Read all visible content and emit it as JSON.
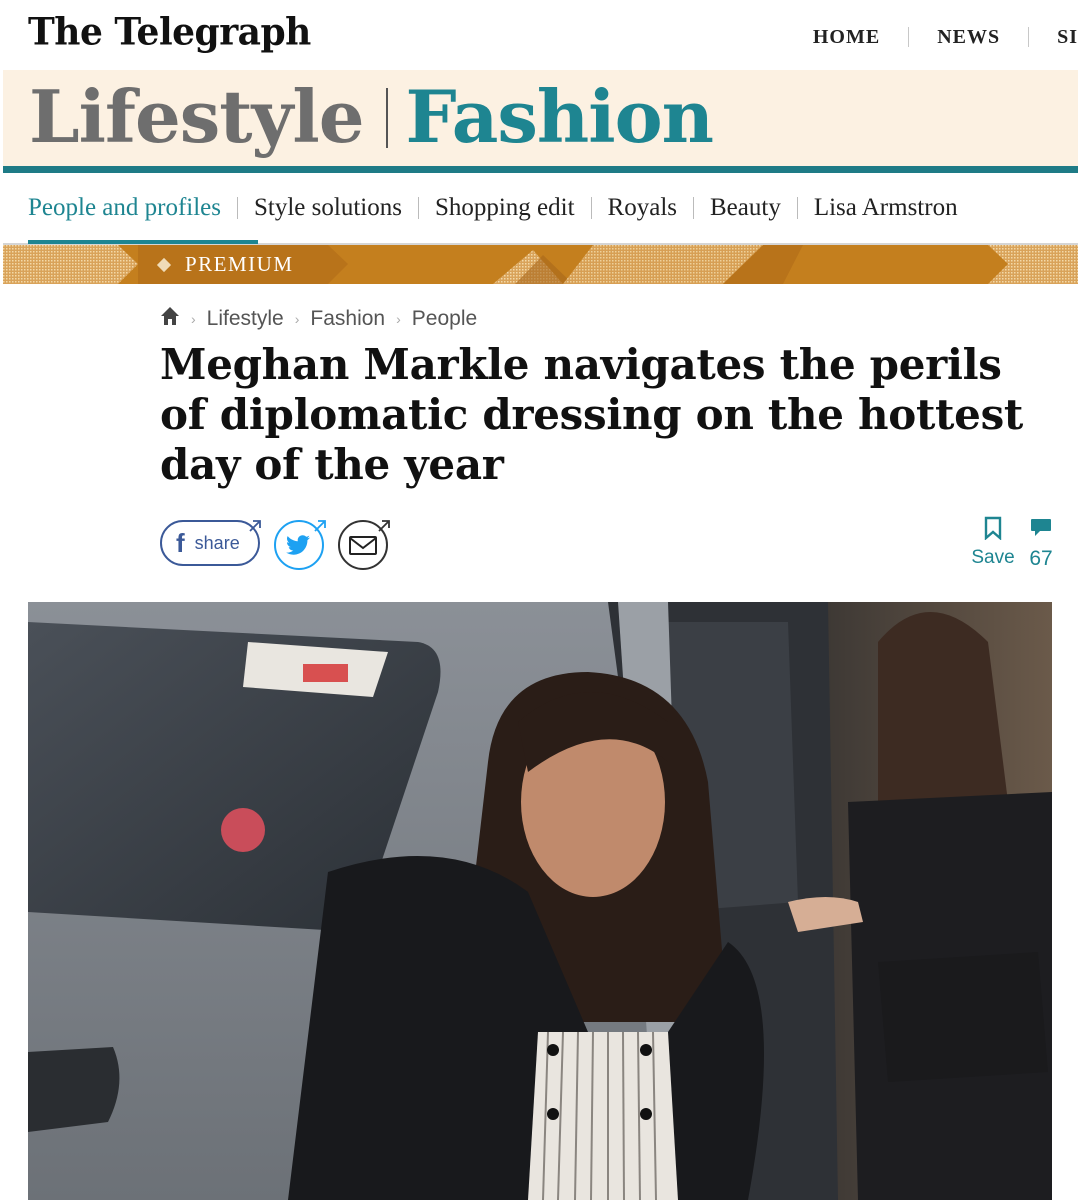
{
  "masthead": {
    "logo": "The Telegraph",
    "nav": [
      "HOME",
      "NEWS",
      "SI"
    ]
  },
  "section": {
    "primary": "Lifestyle",
    "secondary": "Fashion"
  },
  "subnav": {
    "items": [
      "People and profiles",
      "Style solutions",
      "Shopping edit",
      "Royals",
      "Beauty",
      "Lisa Armstron"
    ],
    "active_index": 0
  },
  "premium": {
    "label": "PREMIUM"
  },
  "breadcrumb": {
    "home_icon": "home-icon",
    "items": [
      "Lifestyle",
      "Fashion",
      "People"
    ]
  },
  "article": {
    "headline": "Meghan Markle navigates the perils of diplomatic dressing on the hottest day of the year"
  },
  "share": {
    "facebook_label": "share",
    "icons": [
      "facebook-icon",
      "twitter-icon",
      "email-icon"
    ]
  },
  "actions": {
    "save_label": "Save",
    "comment_count": "67"
  },
  "colors": {
    "teal": "#1e8591",
    "premium": "#c47f1e",
    "banner_bg": "#fcf1e2",
    "facebook": "#3b5998",
    "twitter": "#1da1f2"
  },
  "hero_image": {
    "subject": "photo"
  }
}
